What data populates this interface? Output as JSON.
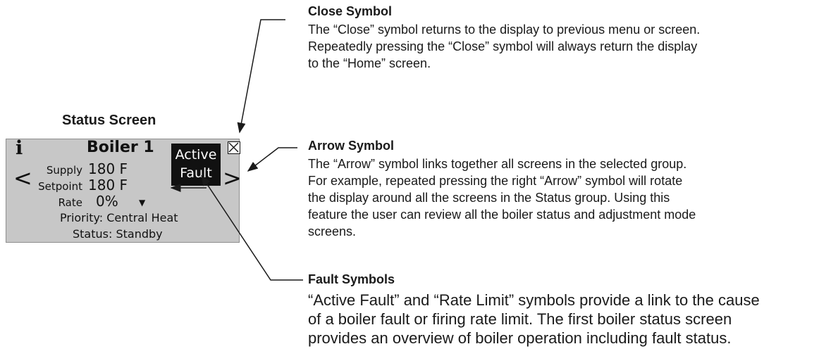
{
  "screen_caption": "Status Screen",
  "screen": {
    "title": "Boiler 1",
    "info_glyph": "i",
    "prev_glyph": "<",
    "next_glyph": ">",
    "fault_line1": "Active",
    "fault_line2": "Fault",
    "supply_label": "Supply",
    "supply_value": "180 F",
    "setpoint_label": "Setpoint",
    "setpoint_value": "180 F",
    "rate_label": "Rate",
    "rate_value": "0%",
    "rate_limit_glyph": "▼",
    "priority": "Priority: Central Heat",
    "status": "Status: Standby"
  },
  "notes": {
    "close": {
      "title": "Close Symbol",
      "lines": [
        "The “Close” symbol returns to the display to previous menu or screen.",
        "Repeatedly pressing the “Close” symbol will always return the display",
        "to the “Home” screen."
      ]
    },
    "arrow": {
      "title": "Arrow Symbol",
      "lines": [
        "The “Arrow” symbol links together all screens in the selected group.",
        "For example, repeated pressing the right “Arrow” symbol will rotate",
        "the display around all the screens in the Status group.  Using this",
        "feature the user can review all the boiler status and adjustment mode",
        "screens."
      ]
    },
    "fault": {
      "title": "Fault Symbols",
      "lines": [
        "“Active Fault” and “Rate Limit” symbols provide a link to the cause",
        "of a boiler fault or firing rate limit.  The first boiler status screen",
        "provides an overview of boiler operation including fault status."
      ]
    }
  }
}
